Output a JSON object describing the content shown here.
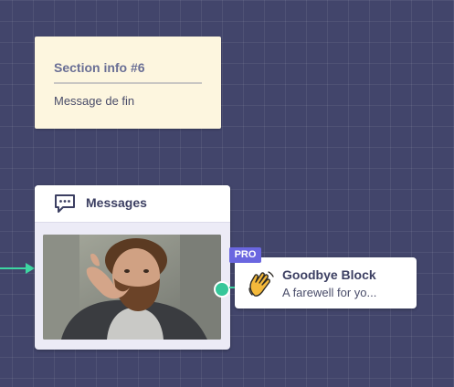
{
  "note": {
    "title": "Section info #6",
    "text": "Message de fin"
  },
  "messages_block": {
    "title": "Messages",
    "icon": "chat-bubble-icon",
    "media": "gif-image"
  },
  "goodbye_block": {
    "badge": "PRO",
    "icon": "waving-hand-icon",
    "title": "Goodbye Block",
    "subtitle": "A farewell for yo..."
  },
  "colors": {
    "canvas": "#42456b",
    "connector": "#3dd6a2",
    "badge": "#6a66e0",
    "note": "#fdf6df"
  }
}
